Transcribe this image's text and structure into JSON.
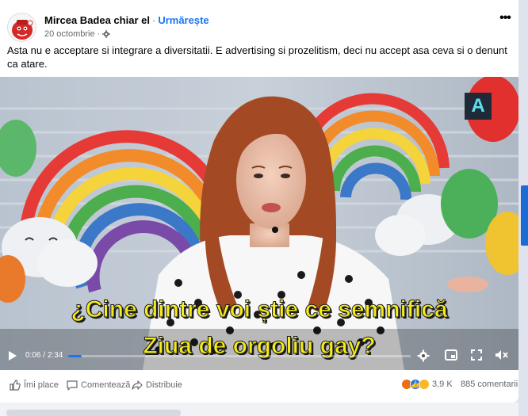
{
  "post": {
    "author": "Mircea Badea chiar el",
    "separator": "·",
    "follow_label": "Urmărește",
    "date": "20 octombrie",
    "privacy_icon": "gear-icon",
    "text": "Asta nu e acceptare si integrare a diversitatii. E advertising si prozelitism, deci nu accept asa ceva si o denunt ca atare."
  },
  "video": {
    "channel_logo": "A",
    "caption_line1": "¿Cine dintre voi știe ce semnifică",
    "caption_line2": "Ziua de orgoliu gay?",
    "time_current": "0:06",
    "time_sep": " / ",
    "time_total": "2:34",
    "progress_fraction": 0.04
  },
  "actions": {
    "like_label": "Îmi place",
    "comment_label": "Comentează",
    "share_label": "Distribuie",
    "reaction_count": "3,9 K",
    "comment_count": "885 comentarii"
  },
  "colors": {
    "accent": "#1877f2",
    "caption_yellow": "#f4ec1a"
  }
}
